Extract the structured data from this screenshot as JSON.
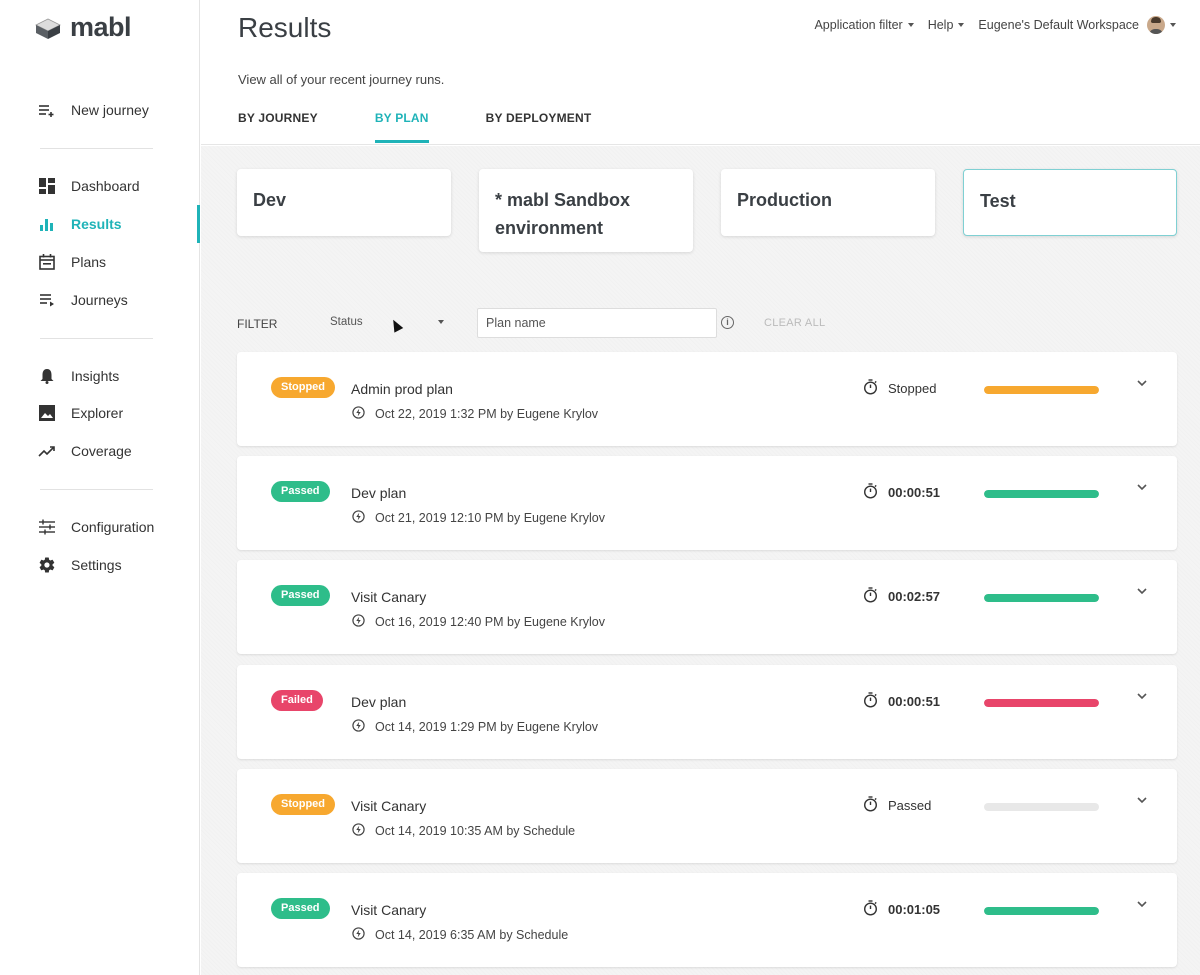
{
  "app": {
    "logo_text": "mabl"
  },
  "sidebar": {
    "items": [
      {
        "label": "New journey",
        "icon": "add-list-icon"
      },
      {
        "label": "Dashboard",
        "icon": "dashboard-icon"
      },
      {
        "label": "Results",
        "icon": "bar-chart-icon",
        "active": true
      },
      {
        "label": "Plans",
        "icon": "calendar-icon"
      },
      {
        "label": "Journeys",
        "icon": "journeys-list-icon"
      },
      {
        "label": "Insights",
        "icon": "bell-icon"
      },
      {
        "label": "Explorer",
        "icon": "image-icon"
      },
      {
        "label": "Coverage",
        "icon": "trend-icon"
      },
      {
        "label": "Configuration",
        "icon": "sliders-icon"
      },
      {
        "label": "Settings",
        "icon": "gear-icon"
      }
    ]
  },
  "header": {
    "title": "Results",
    "subtitle": "View all of your recent journey runs.",
    "application_filter": "Application filter",
    "help": "Help",
    "workspace": "Eugene's Default Workspace",
    "tabs": [
      {
        "label": "BY JOURNEY"
      },
      {
        "label": "BY PLAN",
        "active": true
      },
      {
        "label": "BY DEPLOYMENT"
      }
    ]
  },
  "environments": [
    {
      "label": "Dev"
    },
    {
      "label": "* mabl Sandbox environment"
    },
    {
      "label": "Production"
    },
    {
      "label": "Test",
      "selected": true
    }
  ],
  "filter": {
    "label": "FILTER",
    "status_value": "Status",
    "plan_placeholder": "Plan name",
    "clear_all": "CLEAR ALL"
  },
  "colors": {
    "accent": "#1fb3b8",
    "stopped": "#f7a82f",
    "passed": "#2ebd8a",
    "failed": "#e8456a",
    "empty": "#e8e8e8"
  },
  "runs": [
    {
      "badge": "Stopped",
      "badge_color": "#f7a82f",
      "plan": "Admin prod plan",
      "meta": "Oct 22, 2019 1:32 PM by Eugene Krylov",
      "duration": "Stopped",
      "is_time": false,
      "progress": 1.0,
      "bar_color": "#f7a82f"
    },
    {
      "badge": "Passed",
      "badge_color": "#2ebd8a",
      "plan": "Dev plan",
      "meta": "Oct 21, 2019 12:10 PM by Eugene Krylov",
      "duration": "00:00:51",
      "is_time": true,
      "progress": 1.0,
      "bar_color": "#2ebd8a"
    },
    {
      "badge": "Passed",
      "badge_color": "#2ebd8a",
      "plan": "Visit Canary",
      "meta": "Oct 16, 2019 12:40 PM by Eugene Krylov",
      "duration": "00:02:57",
      "is_time": true,
      "progress": 1.0,
      "bar_color": "#2ebd8a"
    },
    {
      "badge": "Failed",
      "badge_color": "#e8456a",
      "plan": "Dev plan",
      "meta": "Oct 14, 2019 1:29 PM by Eugene Krylov",
      "duration": "00:00:51",
      "is_time": true,
      "progress": 1.0,
      "bar_color": "#e8456a"
    },
    {
      "badge": "Stopped",
      "badge_color": "#f7a82f",
      "plan": "Visit Canary",
      "meta": "Oct 14, 2019 10:35 AM by Schedule",
      "duration": "Passed",
      "is_time": false,
      "progress": 0.0,
      "bar_color": "#e8e8e8"
    },
    {
      "badge": "Passed",
      "badge_color": "#2ebd8a",
      "plan": "Visit Canary",
      "meta": "Oct 14, 2019 6:35 AM by Schedule",
      "duration": "00:01:05",
      "is_time": true,
      "progress": 1.0,
      "bar_color": "#2ebd8a"
    }
  ]
}
